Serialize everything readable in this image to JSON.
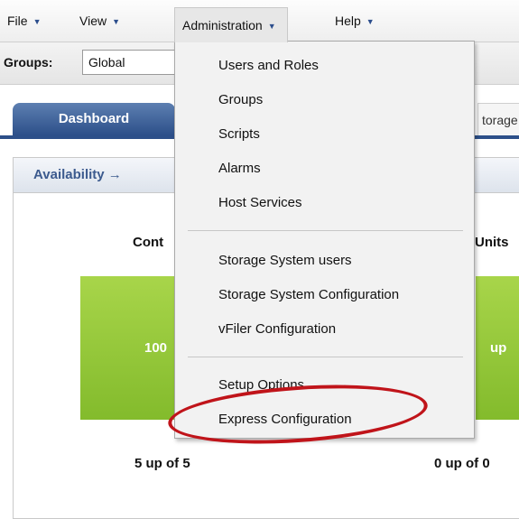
{
  "menubar": {
    "file": "File",
    "view": "View",
    "administration": "Administration",
    "help": "Help",
    "arrow_glyph": "▼"
  },
  "groups": {
    "label": "Groups:",
    "selected": "Global"
  },
  "tabs": {
    "dashboard": "Dashboard",
    "storage_partial": "torage"
  },
  "panel": {
    "title": "Availability →",
    "col1_head_partial": "Cont",
    "col2_head_partial": "Units",
    "col1_value_partial": "100",
    "col2_value_partial": "up",
    "col1_count": "5 up of 5",
    "col2_count": "0 up of 0",
    "green_color": "#8cc43a"
  },
  "dropdown": {
    "items": [
      "Users and Roles",
      "Groups",
      "Scripts",
      "Alarms",
      "Host Services",
      "Storage System users",
      "Storage System Configuration",
      "vFiler Configuration",
      "Setup Options",
      "Express Configuration"
    ]
  },
  "highlight_color": "#c0141a"
}
